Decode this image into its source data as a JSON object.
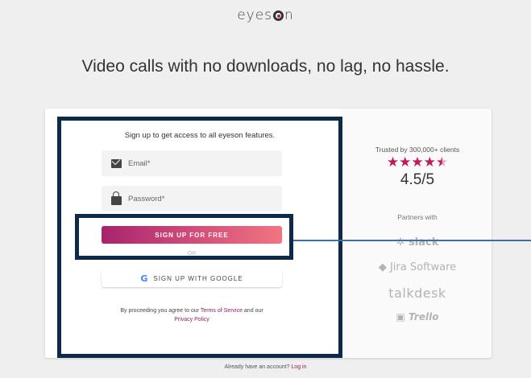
{
  "brand": {
    "logo_prefix": "eyes",
    "logo_suffix": "n"
  },
  "headline": "Video calls with no downloads, no lag, no hassle.",
  "form": {
    "intro": "Sign up to get access to all eyeson features.",
    "email_placeholder": "Email*",
    "password_placeholder": "Password*",
    "signup_label": "SIGN UP FOR FREE",
    "or_label": "OR",
    "google_label": "SIGN UP WITH GOOGLE",
    "terms_prefix": "By proceeding you agree to our ",
    "terms_link": "Terms of Service",
    "terms_middle": " and our",
    "privacy_link": "Privacy Policy"
  },
  "trust": {
    "trusted_text": "Trusted by 300,000+ clients",
    "stars": "★★★★",
    "rating_value": 4.5,
    "rating": "4.5/5",
    "partners_label": "Partners with",
    "partners": [
      "slack",
      "Jira Software",
      "talkdesk",
      "Trello"
    ]
  },
  "footer": {
    "already_text": "Already have an account? ",
    "login_link": "Log in"
  },
  "colors": {
    "accent": "#c2185b",
    "annotation_box": "#0d2a4a",
    "connector_line": "#3b6fa5"
  }
}
